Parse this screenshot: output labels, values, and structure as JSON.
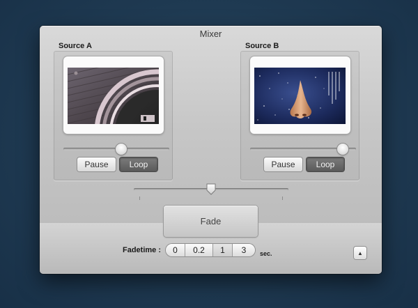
{
  "window": {
    "title": "Mixer"
  },
  "source_a": {
    "label": "Source A",
    "preview": "disc-preview",
    "volume_fraction": 0.55,
    "pause_label": "Pause",
    "loop_label": "Loop",
    "loop_active": true
  },
  "source_b": {
    "label": "Source B",
    "preview": "nose-space-preview",
    "volume_fraction": 0.92,
    "pause_label": "Pause",
    "loop_label": "Loop",
    "loop_active": true
  },
  "crossfader": {
    "position_fraction": 0.5
  },
  "fade": {
    "label": "Fade"
  },
  "fadetime": {
    "label": "Fadetime :",
    "options": [
      "0",
      "0.2",
      "1",
      "3"
    ],
    "selected": "1",
    "unit": "sec."
  },
  "corner_button": {
    "icon": "up-triangle-icon",
    "glyph": "▲"
  },
  "colors": {
    "background": "#1f3a52",
    "window": "#c7c7c7",
    "loop_button": "#5f5f5f"
  }
}
